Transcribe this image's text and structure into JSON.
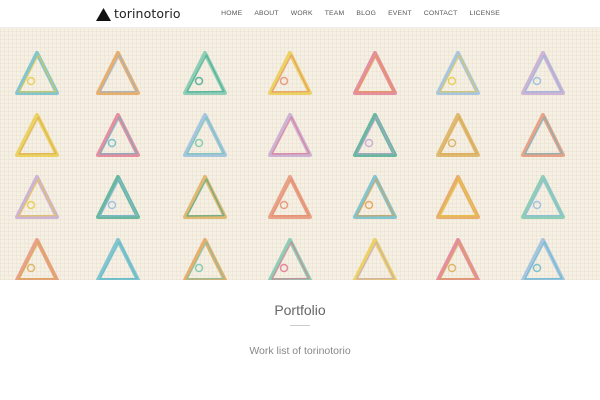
{
  "brand": {
    "name": "torinotorio"
  },
  "nav": {
    "items": [
      "HOME",
      "ABOUT",
      "WORK",
      "TEAM",
      "BLOG",
      "EVENT",
      "CONTACT",
      "LICENSE"
    ]
  },
  "main": {
    "title": "Portfolio",
    "subtitle": "Work list of torinotorio"
  },
  "colors": {
    "hero_background": "#f5efe4",
    "triangle_palette": [
      "#5db8c8",
      "#e39a45",
      "#6dc4a8",
      "#e8c93a",
      "#e06f8a",
      "#8fb8e0",
      "#c0a0d0",
      "#3aa58a",
      "#d9a84e",
      "#e48a6a"
    ]
  }
}
